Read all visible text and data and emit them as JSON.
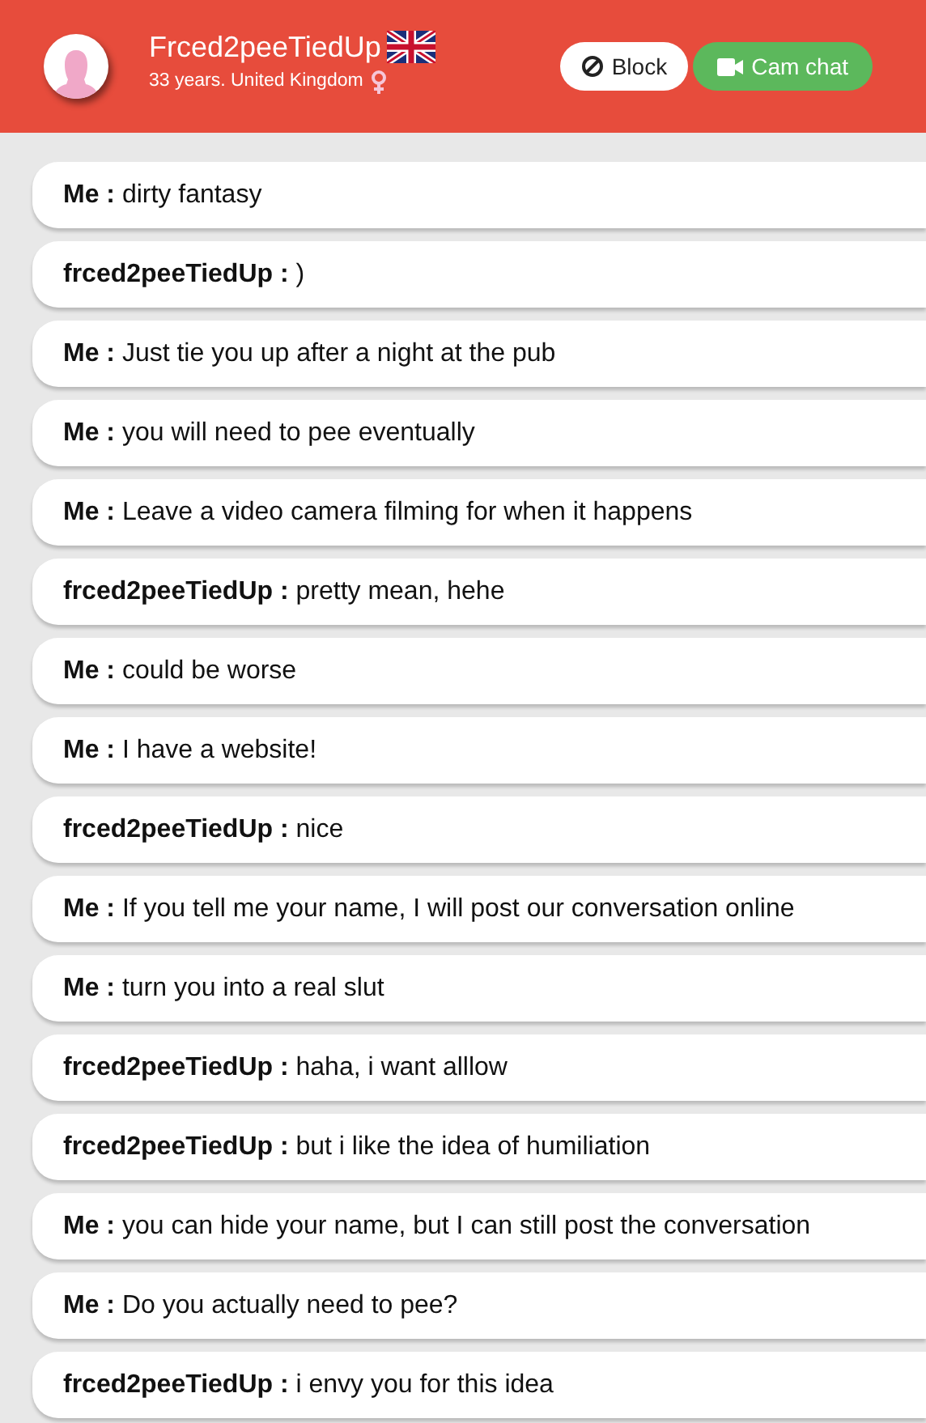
{
  "header": {
    "name": "Frced2peeTiedUp",
    "subtitle": "33 years. United Kingdom",
    "buttons": [
      {
        "kind": "block",
        "label": "Block"
      },
      {
        "kind": "cam",
        "label": "Cam chat"
      }
    ]
  },
  "messages": [
    {
      "sender": "Me :",
      "text": "dirty fantasy"
    },
    {
      "sender": "frced2peeTiedUp :",
      "text": ")"
    },
    {
      "sender": "Me :",
      "text": "Just tie you up after a night at the pub"
    },
    {
      "sender": "Me :",
      "text": "you will need to pee eventually"
    },
    {
      "sender": "Me :",
      "text": "Leave a video camera filming for when it happens"
    },
    {
      "sender": "frced2peeTiedUp :",
      "text": "pretty mean, hehe"
    },
    {
      "sender": "Me :",
      "text": "could be worse"
    },
    {
      "sender": "Me :",
      "text": "I have a website!"
    },
    {
      "sender": "frced2peeTiedUp :",
      "text": "nice"
    },
    {
      "sender": "Me :",
      "text": "If you tell me your name, I will post our conversation online"
    },
    {
      "sender": "Me :",
      "text": "turn you into a real slut"
    },
    {
      "sender": "frced2peeTiedUp :",
      "text": "haha, i want alllow"
    },
    {
      "sender": "frced2peeTiedUp :",
      "text": "but i like the idea of humiliation"
    },
    {
      "sender": "Me :",
      "text": "you can hide your name, but I can still post the conversation"
    },
    {
      "sender": "Me :",
      "text": "Do you actually need to pee?"
    },
    {
      "sender": "frced2peeTiedUp :",
      "text": "i envy you for this idea"
    }
  ]
}
